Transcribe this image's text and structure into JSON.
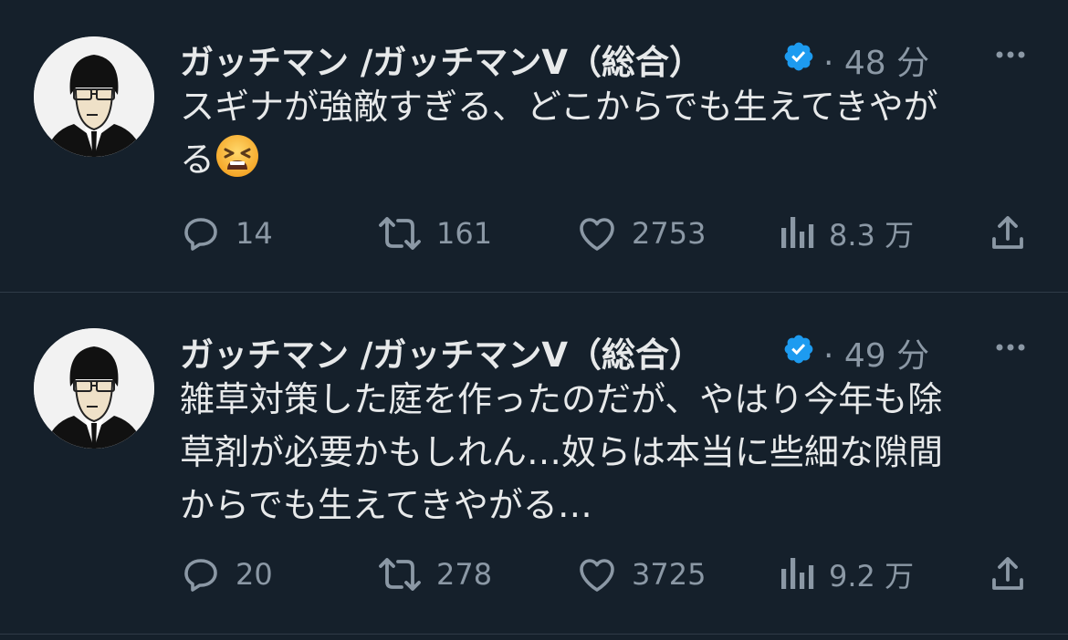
{
  "tweets": [
    {
      "author": "ガッチマン /ガッチマンV（総合）",
      "time": "· 48 分",
      "text_lines": [
        "スギナが強敵すぎる、どこからでも生えてきやが",
        "る"
      ],
      "emoji": "tired-face-emoji",
      "replies": "14",
      "retweets": "161",
      "likes": "2753",
      "views": "8.3 万"
    },
    {
      "author": "ガッチマン /ガッチマンV（総合）",
      "time": "· 49 分",
      "text_lines": [
        "雑草対策した庭を作ったのだが、やはり今年も除",
        "草剤が必要かもしれん…奴らは本当に些細な隙間",
        "からでも生えてきやがる…"
      ],
      "replies": "20",
      "retweets": "278",
      "likes": "3725",
      "views": "9.2 万"
    }
  ],
  "colors": {
    "background": "#15202b",
    "text": "#e7e9ea",
    "muted": "#8b98a5",
    "verified": "#1d9bf0",
    "divider": "#2f3b47"
  },
  "icons": [
    "reply-icon",
    "retweet-icon",
    "like-icon",
    "views-icon",
    "share-icon",
    "more-icon",
    "verified-badge-icon"
  ]
}
